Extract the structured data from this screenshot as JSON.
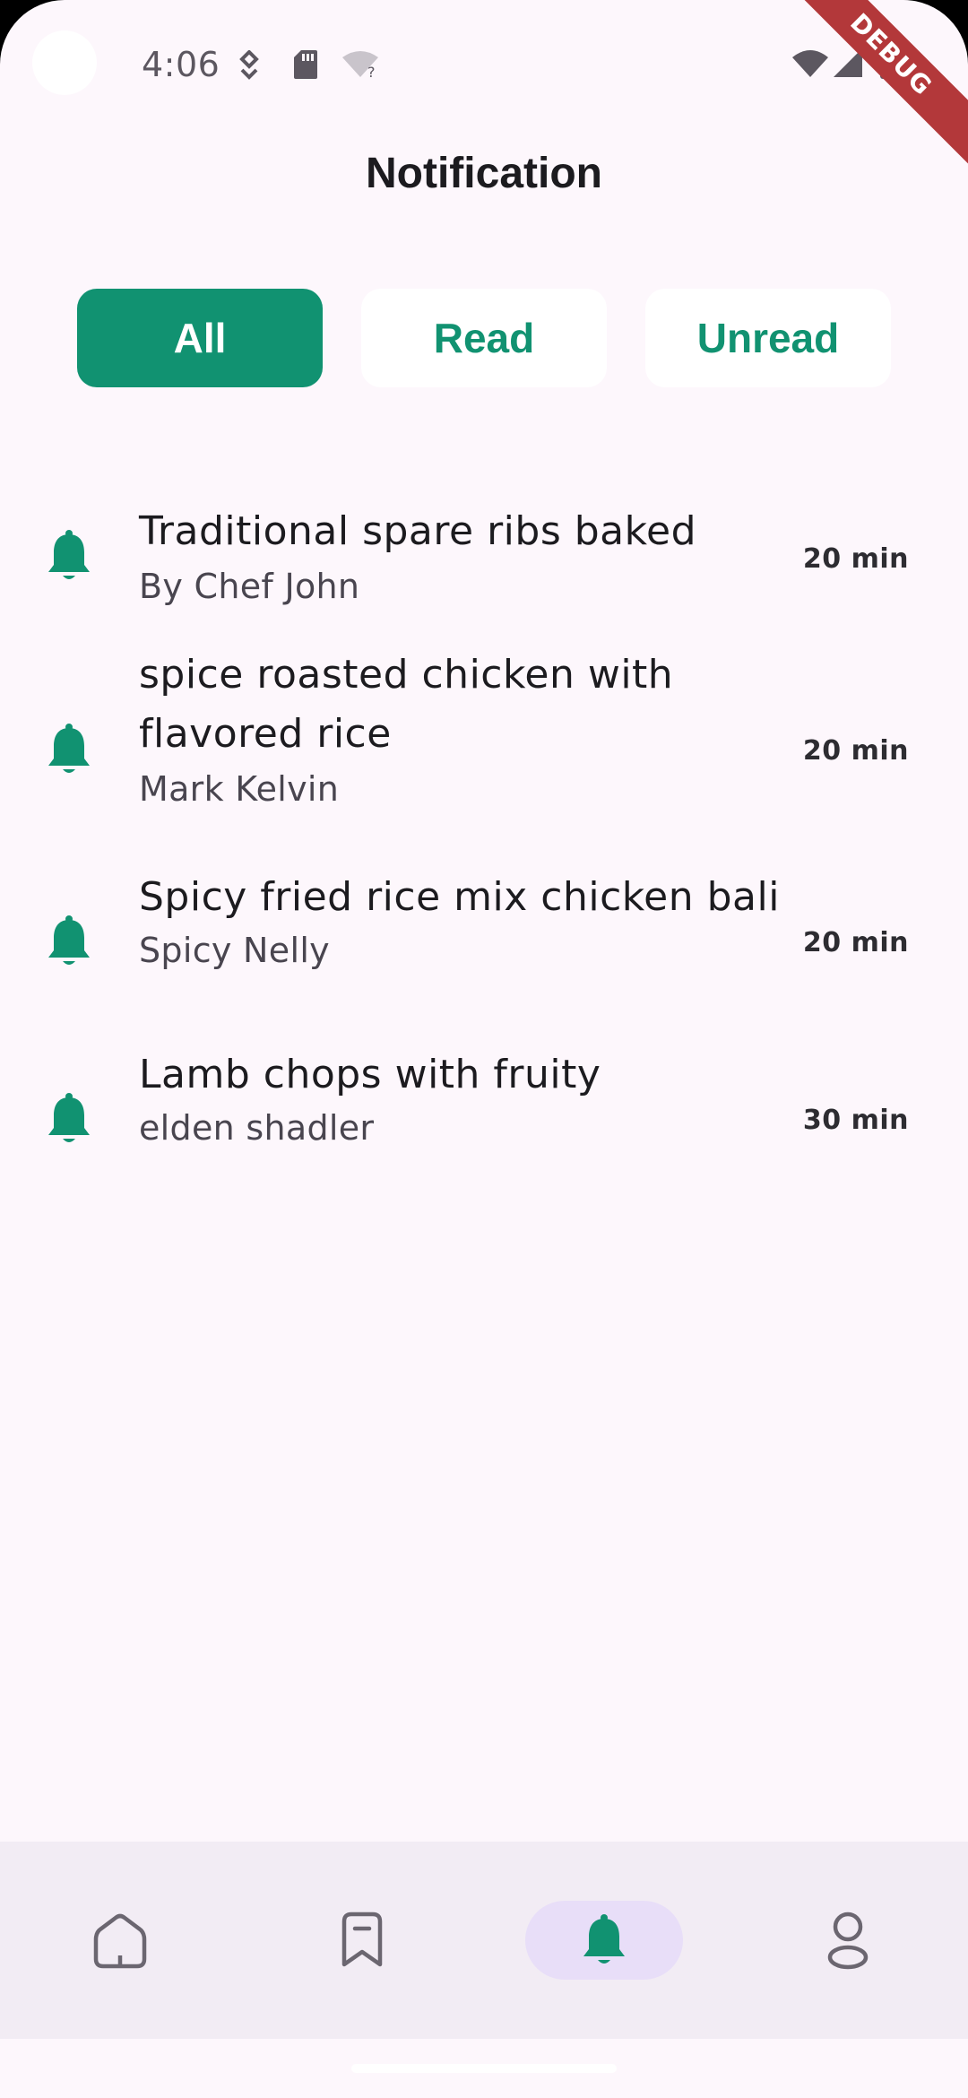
{
  "status_bar": {
    "time": "4:06",
    "icons": [
      "camera-cutout",
      "location-icon",
      "sd-card-icon",
      "wifi-unknown-icon",
      "wifi-icon",
      "signal-icon",
      "battery-icon"
    ],
    "debug_label": "DEBUG"
  },
  "header": {
    "title": "Notification"
  },
  "tabs": [
    {
      "label": "All",
      "active": true
    },
    {
      "label": "Read",
      "active": false
    },
    {
      "label": "Unread",
      "active": false
    }
  ],
  "notifications": [
    {
      "title": "Traditional spare ribs baked",
      "subtitle": "By Chef John",
      "time": "20 min"
    },
    {
      "title": "spice roasted chicken with flavored rice",
      "subtitle": "Mark Kelvin",
      "time": "20 min"
    },
    {
      "title": "Spicy fried rice mix chicken bali",
      "subtitle": "Spicy Nelly",
      "time": "20 min"
    },
    {
      "title": "Lamb chops with fruity",
      "subtitle": "elden shadler",
      "time": "30 min"
    }
  ],
  "bottom_nav": {
    "items": [
      {
        "icon": "home-icon",
        "active": false
      },
      {
        "icon": "bookmark-icon",
        "active": false
      },
      {
        "icon": "bell-icon",
        "active": true
      },
      {
        "icon": "profile-icon",
        "active": false
      }
    ]
  },
  "colors": {
    "accent": "#119271",
    "background": "#fdf7fc",
    "nav_background": "#f2ecf4",
    "nav_active_pill": "#e8def8",
    "debug_ribbon": "#b3383a"
  }
}
